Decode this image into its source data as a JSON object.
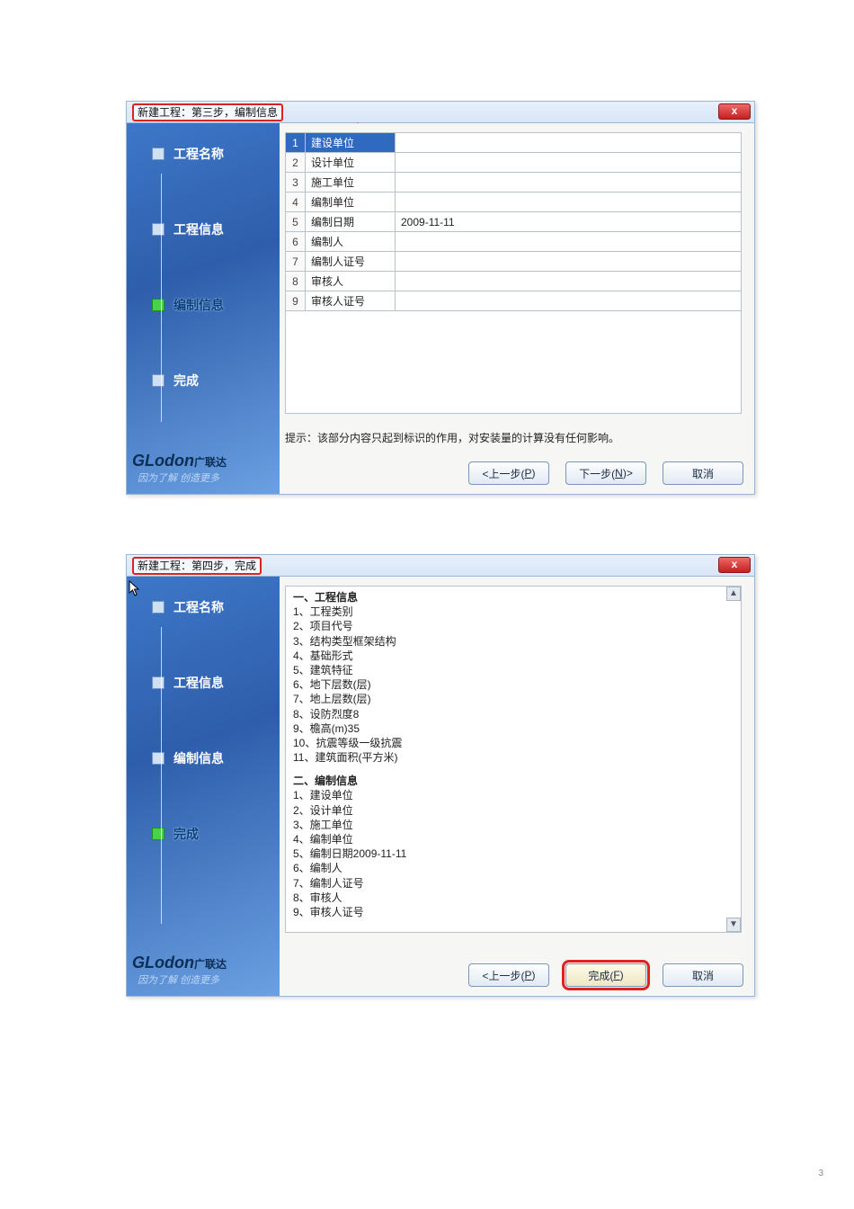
{
  "page_number": "3",
  "dialog1": {
    "title": "新建工程：第三步，编制信息",
    "close": "x",
    "sidebar": {
      "steps": [
        {
          "label": "工程名称",
          "active": false
        },
        {
          "label": "工程信息",
          "active": false
        },
        {
          "label": "编制信息",
          "active": true
        },
        {
          "label": "完成",
          "active": false
        }
      ],
      "brand_en": "GLodon",
      "brand_cn": "广联达",
      "slogan": "因为了解 创造更多"
    },
    "rows": [
      {
        "idx": "1",
        "key": "建设单位",
        "val": "",
        "selected": true
      },
      {
        "idx": "2",
        "key": "设计单位",
        "val": ""
      },
      {
        "idx": "3",
        "key": "施工单位",
        "val": ""
      },
      {
        "idx": "4",
        "key": "编制单位",
        "val": ""
      },
      {
        "idx": "5",
        "key": "编制日期",
        "val": "2009-11-11"
      },
      {
        "idx": "6",
        "key": "编制人",
        "val": ""
      },
      {
        "idx": "7",
        "key": "编制人证号",
        "val": ""
      },
      {
        "idx": "8",
        "key": "审核人",
        "val": ""
      },
      {
        "idx": "9",
        "key": "审核人证号",
        "val": ""
      }
    ],
    "hint": "提示：该部分内容只起到标识的作用，对安装量的计算没有任何影响。",
    "buttons": {
      "prev_left": "<上一步(",
      "prev_u": "P",
      "prev_right": ")",
      "next_left": "下一步(",
      "next_u": "N",
      "next_right": ")>",
      "cancel": "取消"
    }
  },
  "dialog2": {
    "title": "新建工程：第四步，完成",
    "close": "x",
    "sidebar": {
      "steps": [
        {
          "label": "工程名称",
          "active": false
        },
        {
          "label": "工程信息",
          "active": false
        },
        {
          "label": "编制信息",
          "active": false
        },
        {
          "label": "完成",
          "active": true
        }
      ],
      "brand_en": "GLodon",
      "brand_cn": "广联达",
      "slogan": "因为了解 创造更多"
    },
    "summary": {
      "section1_title": "一、工程信息",
      "section1": [
        "1、工程类别",
        "2、项目代号",
        "3、结构类型框架结构",
        "4、基础形式",
        "5、建筑特征",
        "6、地下层数(层)",
        "7、地上层数(层)",
        "8、设防烈度8",
        "9、檐高(m)35",
        "10、抗震等级一级抗震",
        "11、建筑面积(平方米)"
      ],
      "section2_title": "二、编制信息",
      "section2": [
        "1、建设单位",
        "2、设计单位",
        "3、施工单位",
        "4、编制单位",
        "5、编制日期2009-11-11",
        "6、编制人",
        "7、编制人证号",
        "8、审核人",
        "9、审核人证号"
      ],
      "scroll_up": "▲",
      "scroll_down": "▼"
    },
    "buttons": {
      "prev_left": "<上一步(",
      "prev_u": "P",
      "prev_right": ")",
      "finish_left": "完成(",
      "finish_u": "F",
      "finish_right": ")",
      "cancel": "取消"
    }
  }
}
